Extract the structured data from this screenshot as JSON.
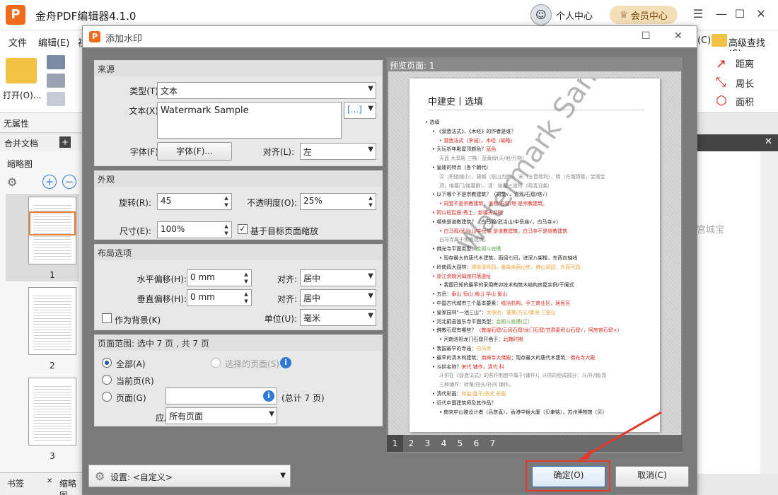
{
  "app": {
    "title": "金舟PDF编辑器4.1.0",
    "logo_letter": "P",
    "user_center": "个人中心",
    "member_center": "会员中心",
    "minimize": "—",
    "maximize": "☐",
    "close": "✕",
    "menu_icon": "☰"
  },
  "menu": {
    "file": "文件",
    "edit": "编辑(E)",
    "view": "视",
    "right_partial": "(C)",
    "advanced_find": "高级查找(S)"
  },
  "toolbar": {
    "open": "打开(O)...",
    "distance": "距离",
    "perimeter": "周长",
    "area": "面积"
  },
  "left": {
    "no_attr": "无属性",
    "merge_doc_tab": "合并文档",
    "thumb_panel_title": "缩略图",
    "pages": [
      "1",
      "2",
      "3"
    ],
    "bottom_tab_bookmark": "书签",
    "bottom_tab_thumb": "缩略图"
  },
  "right": {
    "watermark_side_text": "宫城宝"
  },
  "dialog": {
    "title": "添加水印",
    "source": {
      "heading": "来源",
      "type_label": "类型(T):",
      "type_value": "文本",
      "text_label": "文本(X):",
      "text_value": "Watermark Sample",
      "insert_btn": "[...]",
      "font_label": "字体(F):",
      "font_btn": "字体(F)...",
      "align_label": "对齐(L):",
      "align_value": "左"
    },
    "appearance": {
      "heading": "外观",
      "rotation_label": "旋转(R):",
      "rotation_value": "45",
      "opacity_label": "不透明度(O):",
      "opacity_value": "25%",
      "size_label": "尺寸(E):",
      "size_value": "100%",
      "scale_label": "基于目标页面缩放",
      "scale_checked": true
    },
    "layout": {
      "heading": "布局选项",
      "h_offset_label": "水平偏移(H):",
      "h_offset_value": "0 mm",
      "v_offset_label": "垂直偏移(H):",
      "v_offset_value": "0 mm",
      "h_align_label": "对齐:",
      "h_align_value": "居中",
      "v_align_label": "对齐:",
      "v_align_value": "居中",
      "background_label": "作为背景(K)",
      "background_checked": false,
      "unit_label": "单位(U):",
      "unit_value": "毫米"
    },
    "range": {
      "heading": "页面范围: 选中 7 页 , 共 7 页",
      "all": "全部(A)",
      "selected": "选择的页面(S)",
      "current": "当前页(R)",
      "pages": "页面(G)",
      "pages_value": "",
      "total": "(总计 7 页)",
      "apply_label": "应用到:",
      "apply_value": "所有页面"
    },
    "preview": {
      "heading": "预览页面: 1",
      "watermark_text": "Watermark Sample",
      "page_numbers": [
        "1",
        "2",
        "3",
        "4",
        "5",
        "6",
        "7"
      ],
      "selected_page": "1"
    },
    "settings_label": "设置: <自定义>",
    "ok": "确定(O)",
    "cancel": "取消(C)"
  },
  "preview_doc": {
    "title": "中建史丨选填",
    "lines": [
      {
        "indent": 0,
        "parts": [
          {
            "t": "• 选填",
            "c": ""
          }
        ]
      },
      {
        "indent": 1,
        "parts": [
          {
            "t": "• 《营造法式》、《木经》的作者是谁？",
            "c": ""
          }
        ]
      },
      {
        "indent": 2,
        "parts": [
          {
            "t": "• 营造法式（李诫），木经（喻皓）",
            "c": "r"
          }
        ]
      },
      {
        "indent": 1,
        "parts": [
          {
            "t": "• 天坛祈年殿屋顶颜色？",
            "c": ""
          },
          {
            "t": "蓝色",
            "c": "r"
          }
        ]
      },
      {
        "indent": 2,
        "parts": [
          {
            "t": "天蓝 大享殿 三檐：蓝黄绿(天/地/万物)",
            "c": "gr"
          }
        ]
      },
      {
        "indent": 1,
        "parts": [
          {
            "t": "• 皇陵的特点（各个朝代）",
            "c": ""
          }
        ]
      },
      {
        "indent": 2,
        "parts": [
          {
            "t": "汉（积陵缩小）、唐朝（依山为陵）、宋（五音姓利），明（方城明楼，宝城宝",
            "c": "gr"
          }
        ]
      },
      {
        "indent": 2,
        "parts": [
          {
            "t": "顶，唯墓门/陵墓群）、清：陵墓三道阶（明清沿袭）",
            "c": "gr"
          }
        ]
      },
      {
        "indent": 1,
        "parts": [
          {
            "t": "• 以下哪个不是宗教建筑？（祠堂√、道观/石窟/塔√）",
            "c": ""
          }
        ]
      },
      {
        "indent": 2,
        "parts": [
          {
            "t": "• 祠堂不是宗教建筑，道观/石窟/塔 是宗教建筑。",
            "c": "r"
          }
        ]
      },
      {
        "indent": 1,
        "parts": [
          {
            "t": "• 阿以旺民居-秀土，新疆天井院",
            "c": "r"
          }
        ]
      },
      {
        "indent": 1,
        "parts": [
          {
            "t": "• 哪些是道教建筑？（白马观/武当山/中岳庙√，白马寺×）",
            "c": ""
          }
        ]
      },
      {
        "indent": 2,
        "parts": [
          {
            "t": "• 白马观/武当山/中岳庙 是道教建筑，白马寺不是道教建筑",
            "c": "r"
          }
        ]
      },
      {
        "indent": 2,
        "parts": [
          {
            "t": "白马寺属于佛教建筑。",
            "c": "gr"
          }
        ]
      },
      {
        "indent": 1,
        "parts": [
          {
            "t": "• 佛光寺平面类型：",
            "c": ""
          },
          {
            "t": "金厢斗底槽",
            "c": "g"
          }
        ]
      },
      {
        "indent": 2,
        "parts": [
          {
            "t": "• 现存最大的唐代木建筑，面阔七间，进深八架椽，东西向轴线",
            "c": ""
          }
        ]
      },
      {
        "indent": 1,
        "parts": [
          {
            "t": "• 岭南四大园林：",
            "c": ""
          },
          {
            "t": "顺德清晖园，番禺余荫山房，佛山梁园，东莞可园",
            "c": "o"
          }
        ]
      },
      {
        "indent": 1,
        "parts": [
          {
            "t": "• 浙江余姚河姆渡村落遗址",
            "c": "r"
          }
        ]
      },
      {
        "indent": 2,
        "parts": [
          {
            "t": "• 我国已知的最早的采用榫卯技术构筑木结构房屋实例/干阑式",
            "c": ""
          }
        ]
      },
      {
        "indent": 1,
        "parts": [
          {
            "t": "• 五岳：",
            "c": ""
          },
          {
            "t": "泰山 恒山 嵩山 华山 衡山",
            "c": "r"
          }
        ]
      },
      {
        "indent": 1,
        "parts": [
          {
            "t": "• 中国古代城市三个基本要素：",
            "c": ""
          },
          {
            "t": "统治机构、手工商业区、居民区",
            "c": "r"
          }
        ]
      },
      {
        "indent": 1,
        "parts": [
          {
            "t": "• 皇家园林“一池三山”：",
            "c": ""
          },
          {
            "t": "太液池，蓬莱/方丈/瀛洲 三座山",
            "c": "o"
          }
        ]
      },
      {
        "indent": 1,
        "parts": [
          {
            "t": "• 河北蓟县独乐寺平面类型：",
            "c": ""
          },
          {
            "t": "金厢斗底槽(辽)",
            "c": "g"
          }
        ]
      },
      {
        "indent": 1,
        "parts": [
          {
            "t": "• 佛教石窟有哪些？",
            "c": ""
          },
          {
            "t": "（敦煌石窟/云冈石窟/龙门石窟/甘肃麦积山石窟√，阿房宫石窟×）",
            "c": "r"
          }
        ]
      },
      {
        "indent": 2,
        "parts": [
          {
            "t": "• 河南洛阳龙门石窟开凿于：",
            "c": ""
          },
          {
            "t": "北魏时期",
            "c": "r"
          }
        ]
      },
      {
        "indent": 1,
        "parts": [
          {
            "t": "• 我国最早的寺庙：",
            "c": ""
          },
          {
            "t": "白马寺",
            "c": "o"
          }
        ]
      },
      {
        "indent": 1,
        "parts": [
          {
            "t": "• 最早的清木构建筑：",
            "c": ""
          },
          {
            "t": "南禅寺大佛殿",
            "c": "r"
          },
          {
            "t": "；现存最大的唐代木建筑：",
            "c": ""
          },
          {
            "t": "佛光寺大殿",
            "c": "r"
          }
        ]
      },
      {
        "indent": 1,
        "parts": [
          {
            "t": "• 斗拱名称？",
            "c": ""
          },
          {
            "t": "宋代 铺作，清代 科",
            "c": "r"
          }
        ]
      },
      {
        "indent": 2,
        "parts": [
          {
            "t": "斗拱在《营造法式》的各作制度中属于(铺作)；斗拱的组成部分：斗/升/翘/昂",
            "c": "gr"
          }
        ]
      },
      {
        "indent": 2,
        "parts": [
          {
            "t": "三种铺作：转角/柱头/补间 铺作。",
            "c": "gr"
          }
        ]
      },
      {
        "indent": 1,
        "parts": [
          {
            "t": "• 清代彩画：",
            "c": ""
          },
          {
            "t": "和玺/旋子/苏式 彩画",
            "c": "o"
          }
        ]
      },
      {
        "indent": 1,
        "parts": [
          {
            "t": "• 近代中国建筑师及其作品？",
            "c": ""
          }
        ]
      },
      {
        "indent": 2,
        "parts": [
          {
            "t": "• 南京中山陵设计者（吕彦直），香港中银大厦（贝聿铭），苏州博物馆（贝）",
            "c": ""
          }
        ]
      }
    ]
  }
}
